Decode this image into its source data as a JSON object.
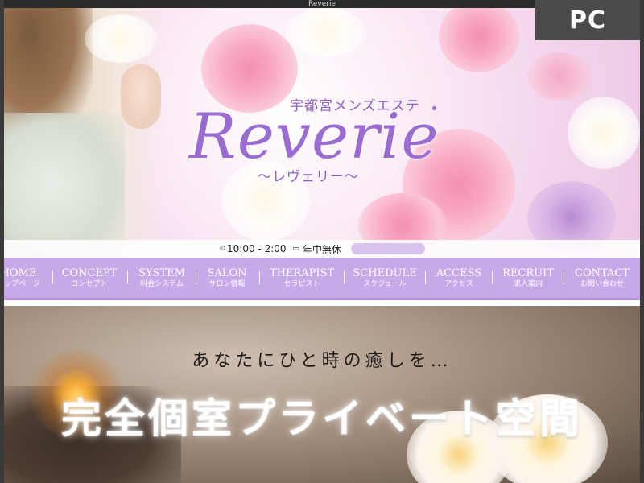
{
  "window": {
    "title": "Reverie"
  },
  "badge": {
    "label": "PC"
  },
  "hero": {
    "logo_sub": "宇都宮メンズエステ",
    "logo_main": "Reverie",
    "logo_kana": "〜レヴェリー〜",
    "hours": "10:00 - 2:00",
    "holiday": "年中無休",
    "accent_color": "#9a6bd1"
  },
  "nav": {
    "bg_color": "#c7a9e8",
    "items": [
      {
        "en": "HOME",
        "jp": "トップページ"
      },
      {
        "en": "CONCEPT",
        "jp": "コンセプト"
      },
      {
        "en": "SYSTEM",
        "jp": "料金システム"
      },
      {
        "en": "SALON",
        "jp": "サロン情報"
      },
      {
        "en": "THERAPIST",
        "jp": "セラピスト"
      },
      {
        "en": "SCHEDULE",
        "jp": "スケジュール"
      },
      {
        "en": "ACCESS",
        "jp": "アクセス"
      },
      {
        "en": "RECRUIT",
        "jp": "求人案内"
      },
      {
        "en": "CONTACT",
        "jp": "お問い合わせ"
      }
    ]
  },
  "banner": {
    "tagline": "あなたにひと時の癒しを…",
    "headline": "完全個室プライベート空間"
  },
  "icons": {
    "clock": "clock-icon",
    "calendar": "calendar-icon"
  }
}
